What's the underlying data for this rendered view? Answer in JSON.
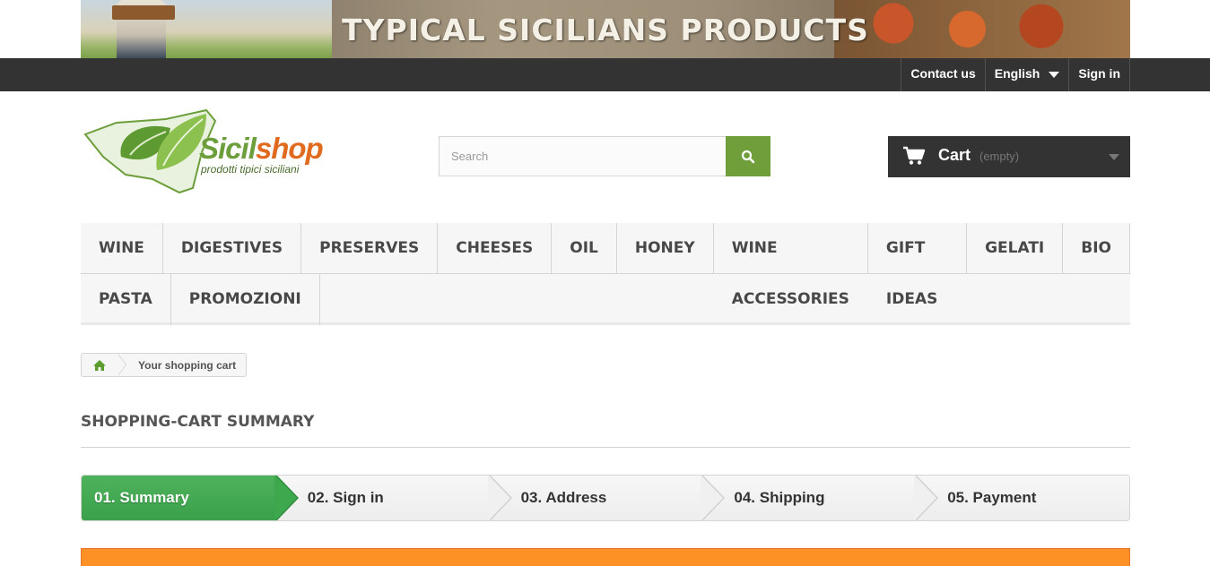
{
  "banner": {
    "title": "TYPICAL SICILIANS PRODUCTS"
  },
  "topnav": {
    "contact": "Contact us",
    "language": "English",
    "signin": "Sign in"
  },
  "logo": {
    "brand_a": "Sicil",
    "brand_b": "shop",
    "tagline": "prodotti tipici siciliani"
  },
  "search": {
    "placeholder": "Search"
  },
  "cart": {
    "label": "Cart",
    "status": "(empty)"
  },
  "menu": {
    "row1": [
      "WINE",
      "DIGESTIVES",
      "PRESERVES",
      "CHEESES",
      "OIL",
      "HONEY",
      "WINE ACCESSORIES",
      "GIFT IDEAS",
      "GELATI",
      "BIO"
    ],
    "row2": [
      "PASTA",
      "PROMOZIONI"
    ]
  },
  "breadcrumb": {
    "current": "Your shopping cart"
  },
  "page": {
    "heading": "SHOPPING-CART SUMMARY"
  },
  "steps": [
    "01. Summary",
    "02. Sign in",
    "03. Address",
    "04. Shipping",
    "05. Payment"
  ],
  "colors": {
    "accent": "#6f9e3a",
    "active_step": "#46ab54",
    "dark": "#333333",
    "alert": "#fe9126"
  }
}
